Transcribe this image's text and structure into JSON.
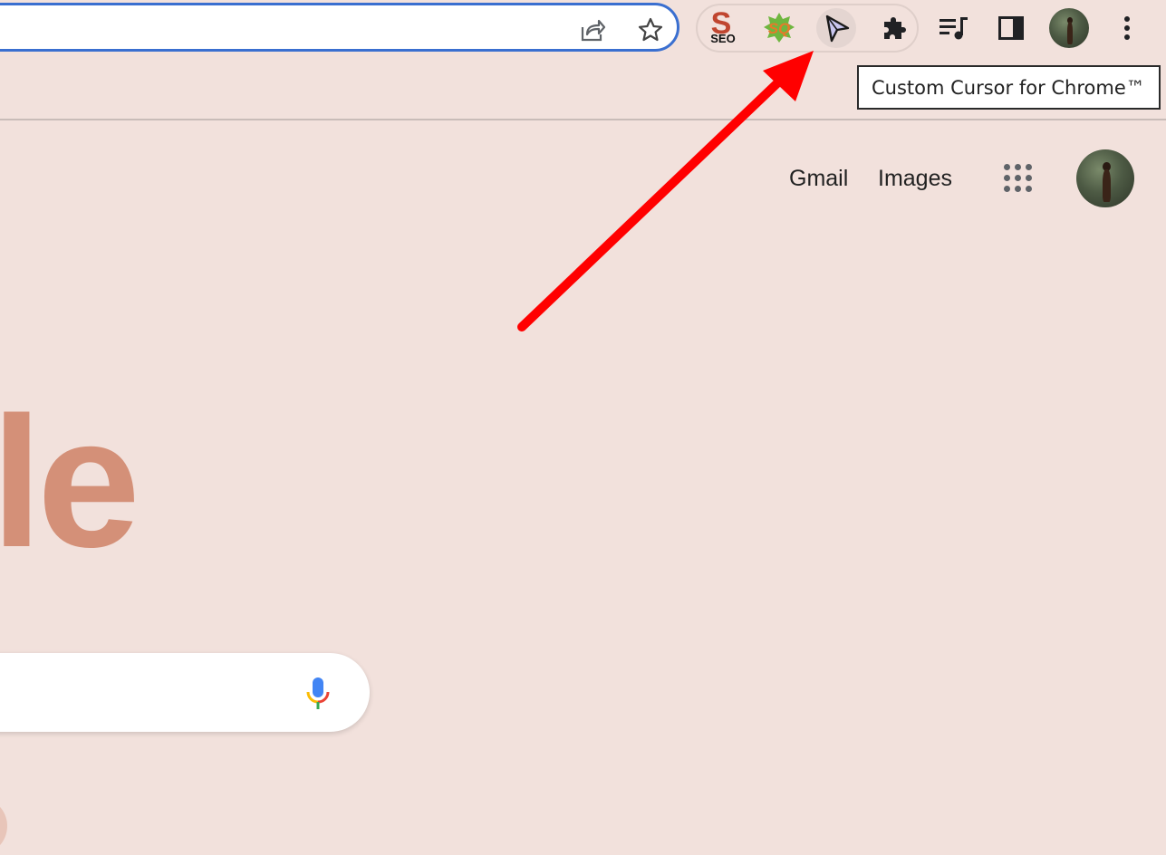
{
  "tooltip": {
    "text": "Custom Cursor for Chrome™"
  },
  "extensions": {
    "seo_label": "SEO",
    "sq_label": "SQ"
  },
  "header_links": {
    "gmail": "Gmail",
    "images": "Images"
  },
  "logo": {
    "visible_fragment": "le"
  },
  "colors": {
    "page_bg": "#f2e1dc",
    "omnibox_border": "#3a6fd0",
    "logo": "#d49078",
    "annotation_arrow": "#ff0000"
  },
  "icons": {
    "share": "share-icon",
    "bookmark": "star-icon",
    "custom_cursor": "cursor-arrow-icon",
    "extensions": "puzzle-icon",
    "media": "playlist-music-icon",
    "side_panel": "side-panel-icon",
    "menu": "kebab-menu-icon",
    "apps": "apps-grid-icon",
    "voice": "microphone-icon"
  }
}
